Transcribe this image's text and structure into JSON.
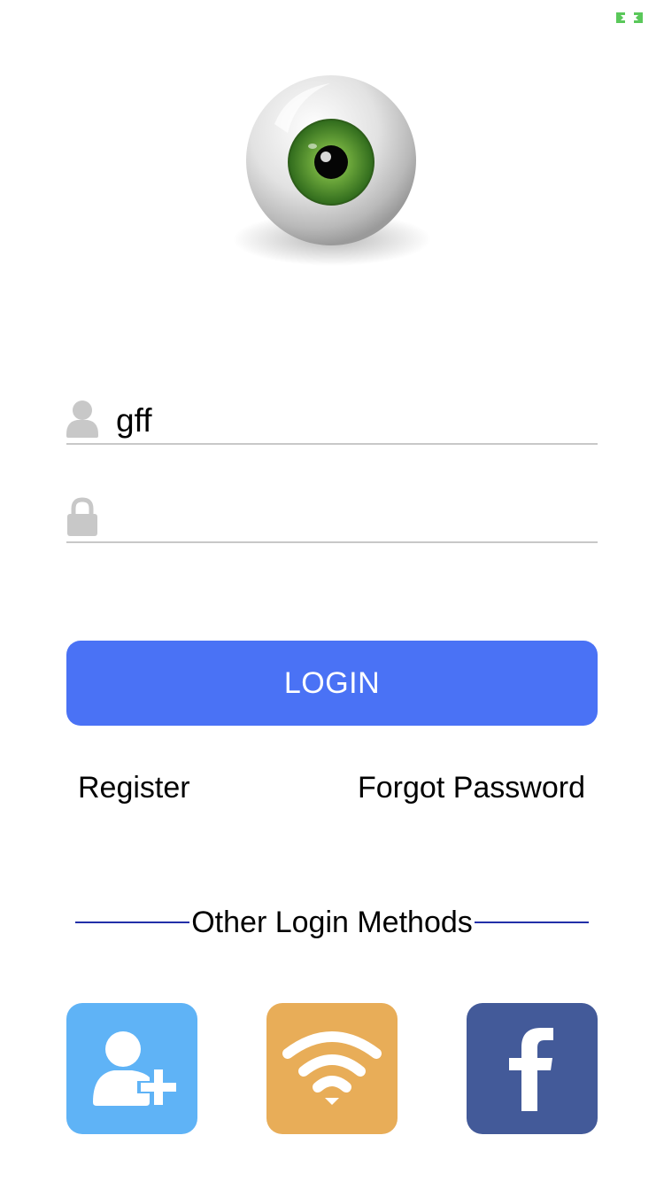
{
  "status": {
    "indicator_icon": "expand-arrows-icon",
    "indicator_color": "#5ac85a"
  },
  "logo": {
    "icon": "eyeball-logo-icon"
  },
  "login_form": {
    "username": {
      "icon": "user-silhouette-icon",
      "value": "gff",
      "placeholder": ""
    },
    "password": {
      "icon": "lock-icon",
      "value": "",
      "placeholder": ""
    },
    "login_label": "LOGIN"
  },
  "links": {
    "register_label": "Register",
    "forgot_label": "Forgot Password"
  },
  "other_login": {
    "label": "Other Login Methods",
    "methods": [
      {
        "icon": "add-user-icon",
        "color": "#5fb3f6"
      },
      {
        "icon": "wifi-icon",
        "color": "#e8ad58"
      },
      {
        "icon": "facebook-icon",
        "color": "#435a99"
      }
    ]
  },
  "colors": {
    "accent": "#4a72f5",
    "divider": "#2230a8",
    "field_underline": "#c8c8c8",
    "field_icon": "#c8c8c8"
  }
}
